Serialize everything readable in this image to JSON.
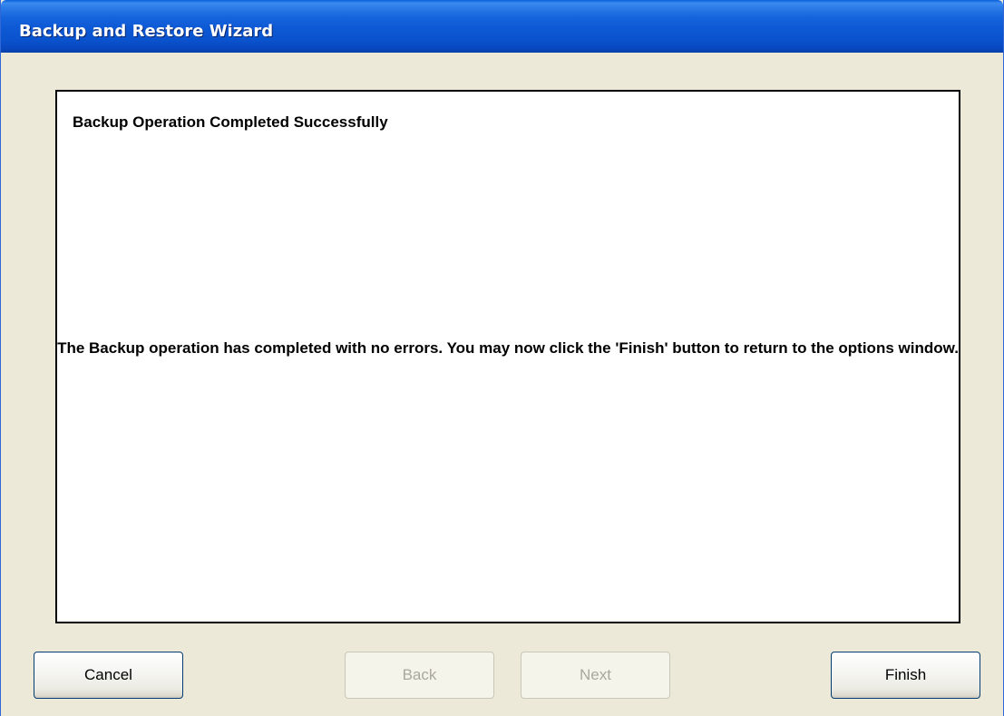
{
  "window": {
    "title": "Backup and Restore Wizard"
  },
  "content": {
    "heading": "Backup Operation Completed Successfully",
    "message": "The Backup operation has completed with no errors. You may now click the 'Finish' button to return to the options window."
  },
  "buttons": {
    "cancel": {
      "label": "Cancel",
      "enabled": true
    },
    "back": {
      "label": "Back",
      "enabled": false
    },
    "next": {
      "label": "Next",
      "enabled": false
    },
    "finish": {
      "label": "Finish",
      "enabled": true
    }
  },
  "colors": {
    "titlebar": "#0a53ce",
    "window_background": "#ece9d8",
    "panel_background": "#ffffff",
    "disabled_text": "#a9a89c"
  }
}
